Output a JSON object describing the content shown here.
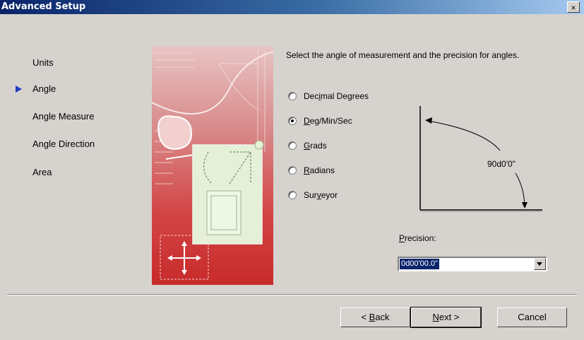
{
  "window": {
    "title": "Advanced Setup",
    "close_label": "×"
  },
  "nav": {
    "items": [
      {
        "label": "Units"
      },
      {
        "label": "Angle"
      },
      {
        "label": "Angle Measure"
      },
      {
        "label": "Angle Direction"
      },
      {
        "label": "Area"
      }
    ],
    "selected": "Angle"
  },
  "instruction": "Select the angle of measurement and the precision for angles.",
  "units": {
    "options": [
      {
        "label": "Decimal Degrees",
        "mnemonic_index": 3
      },
      {
        "label": "Deg/Min/Sec",
        "mnemonic_index": 0
      },
      {
        "label": "Grads",
        "mnemonic_index": 0
      },
      {
        "label": "Radians",
        "mnemonic_index": 0
      },
      {
        "label": "Surveyor",
        "mnemonic_index": 3
      }
    ],
    "selected": "Deg/Min/Sec"
  },
  "diagram": {
    "angle_label": "90d0'0\""
  },
  "precision": {
    "label": "Precision:",
    "value": "0d00'00.0\""
  },
  "buttons": {
    "back": "< Back",
    "next": "Next >",
    "cancel": "Cancel"
  }
}
